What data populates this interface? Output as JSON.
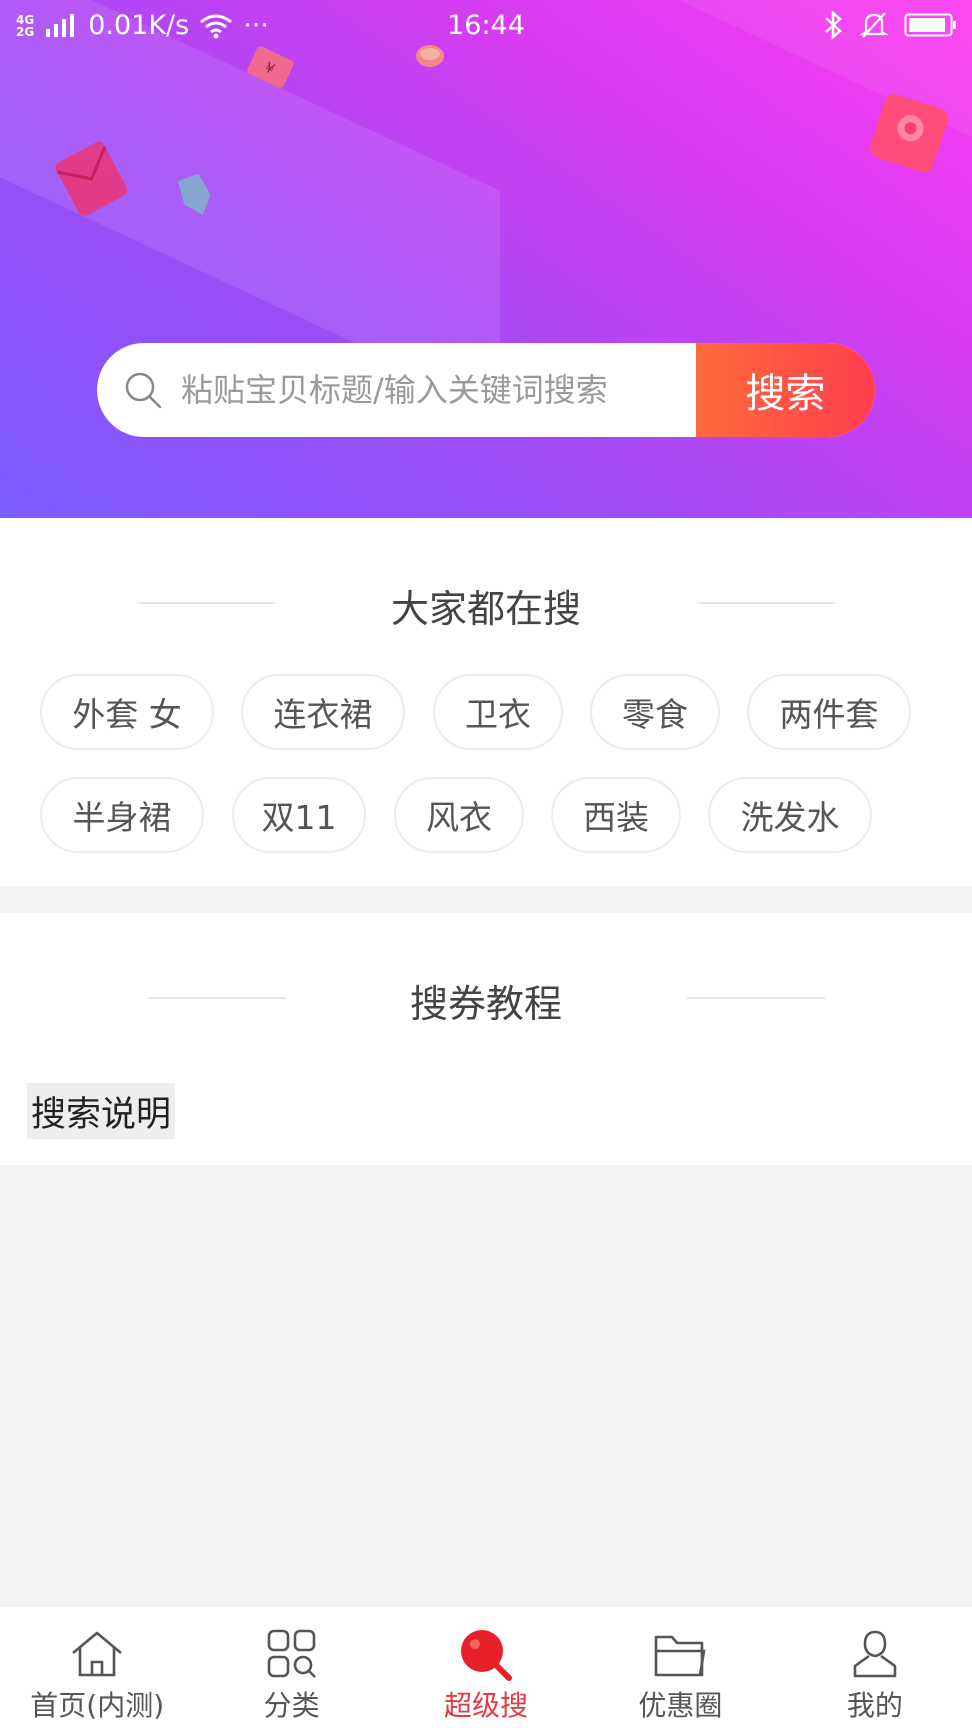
{
  "status_bar": {
    "network_top": "4G",
    "network_bottom": "2G",
    "speed": "0.01K/s",
    "more": "···",
    "time": "16:44"
  },
  "search": {
    "placeholder": "粘贴宝贝标题/输入关键词搜索",
    "button_label": "搜索"
  },
  "hot": {
    "title": "大家都在搜",
    "tags": [
      "外套 女",
      "连衣裙",
      "卫衣",
      "零食",
      "两件套",
      "半身裙",
      "双11",
      "风衣",
      "西装",
      "洗发水"
    ]
  },
  "tutorial": {
    "title": "搜券教程",
    "link_label": "搜索说明"
  },
  "tabbar": {
    "items": [
      {
        "label": "首页(内测)",
        "icon": "home-icon"
      },
      {
        "label": "分类",
        "icon": "category-grid-icon"
      },
      {
        "label": "超级搜",
        "icon": "super-search-icon"
      },
      {
        "label": "优惠圈",
        "icon": "folder-icon"
      },
      {
        "label": "我的",
        "icon": "user-icon"
      }
    ],
    "active_index": 2
  },
  "colors": {
    "accent": "#e53940",
    "search_button": "#ff4a47",
    "hero_start": "#ff3cf0",
    "hero_end": "#7a5cff"
  }
}
